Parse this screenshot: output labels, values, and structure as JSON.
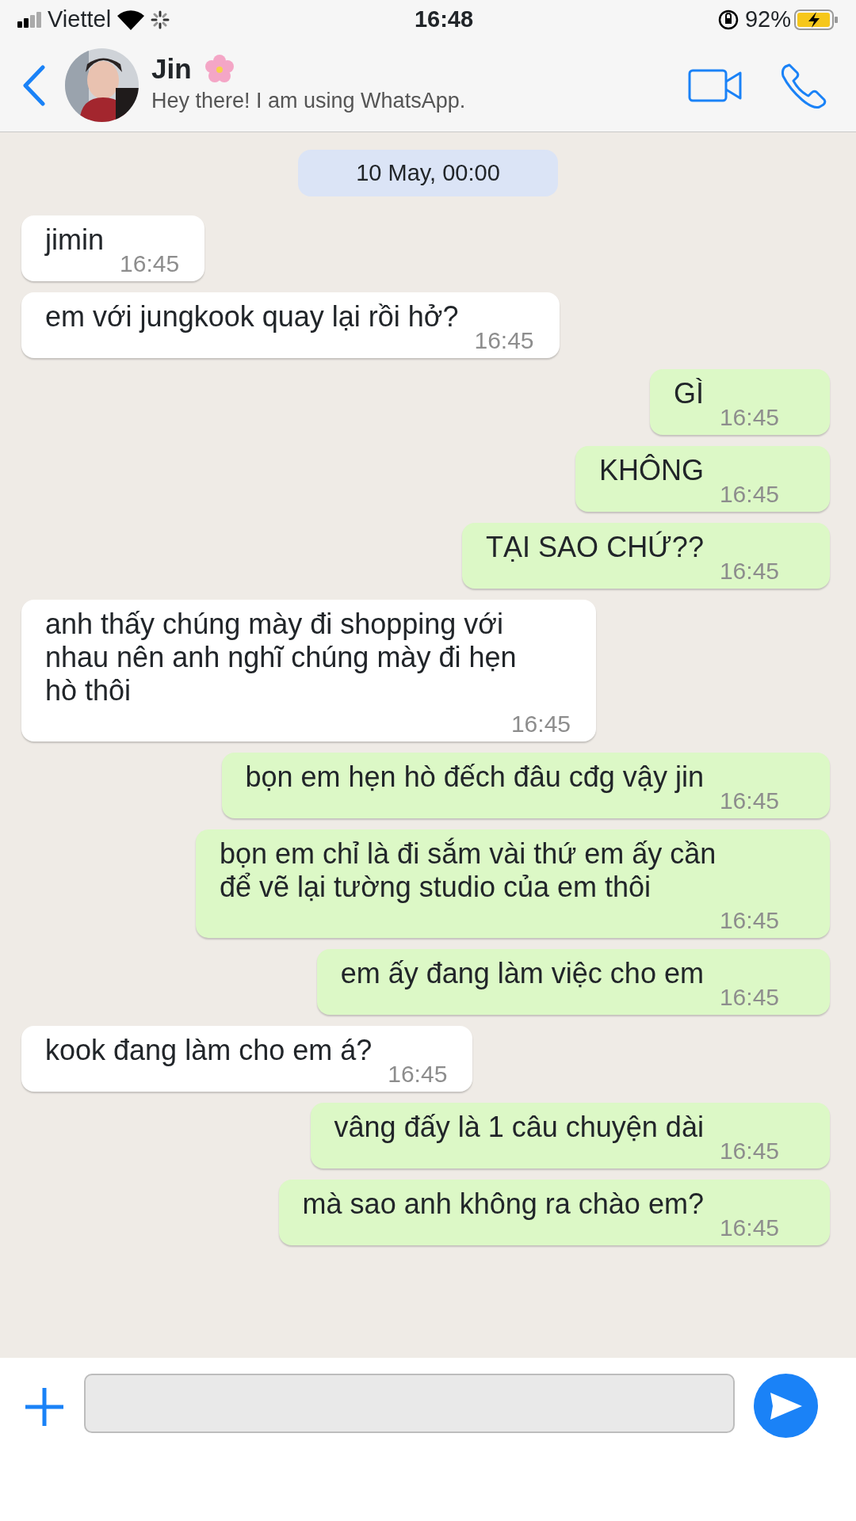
{
  "status_bar": {
    "carrier": "Viettel",
    "time": "16:48",
    "battery": "92%"
  },
  "contact": {
    "name": "Jin",
    "status": "Hey there! I am using WhatsApp."
  },
  "date_divider": "10 May, 00:00",
  "messages": [
    {
      "kind": "incoming",
      "text": "jimin",
      "time": "16:45"
    },
    {
      "kind": "incoming",
      "text": "em với jungkook quay lại rồi hở?",
      "time": "16:45"
    },
    {
      "kind": "outgoing",
      "text": "GÌ",
      "time": "16:45"
    },
    {
      "kind": "outgoing",
      "text": "KHÔNG",
      "time": "16:45"
    },
    {
      "kind": "outgoing",
      "text": "TẠI SAO CHỨ??",
      "time": "16:45"
    },
    {
      "kind": "incoming",
      "text": "anh thấy chúng mày đi shopping với nhau nên anh nghĩ chúng mày đi hẹn hò thôi",
      "time": "16:45"
    },
    {
      "kind": "outgoing",
      "text": "bọn em hẹn hò đếch đâu cđg vậy jin",
      "time": "16:45"
    },
    {
      "kind": "outgoing",
      "text": "bọn em chỉ là đi sắm vài thứ em ấy cần để vẽ lại tường studio của em thôi",
      "time": "16:45"
    },
    {
      "kind": "outgoing",
      "text": "em ấy đang làm việc cho em",
      "time": "16:45"
    },
    {
      "kind": "incoming",
      "text": "kook đang làm cho em á?",
      "time": "16:45"
    },
    {
      "kind": "outgoing",
      "text": "vâng đấy là 1 câu chuyện dài",
      "time": "16:45"
    },
    {
      "kind": "outgoing",
      "text": "mà sao anh không ra chào em?",
      "time": "16:45"
    }
  ]
}
